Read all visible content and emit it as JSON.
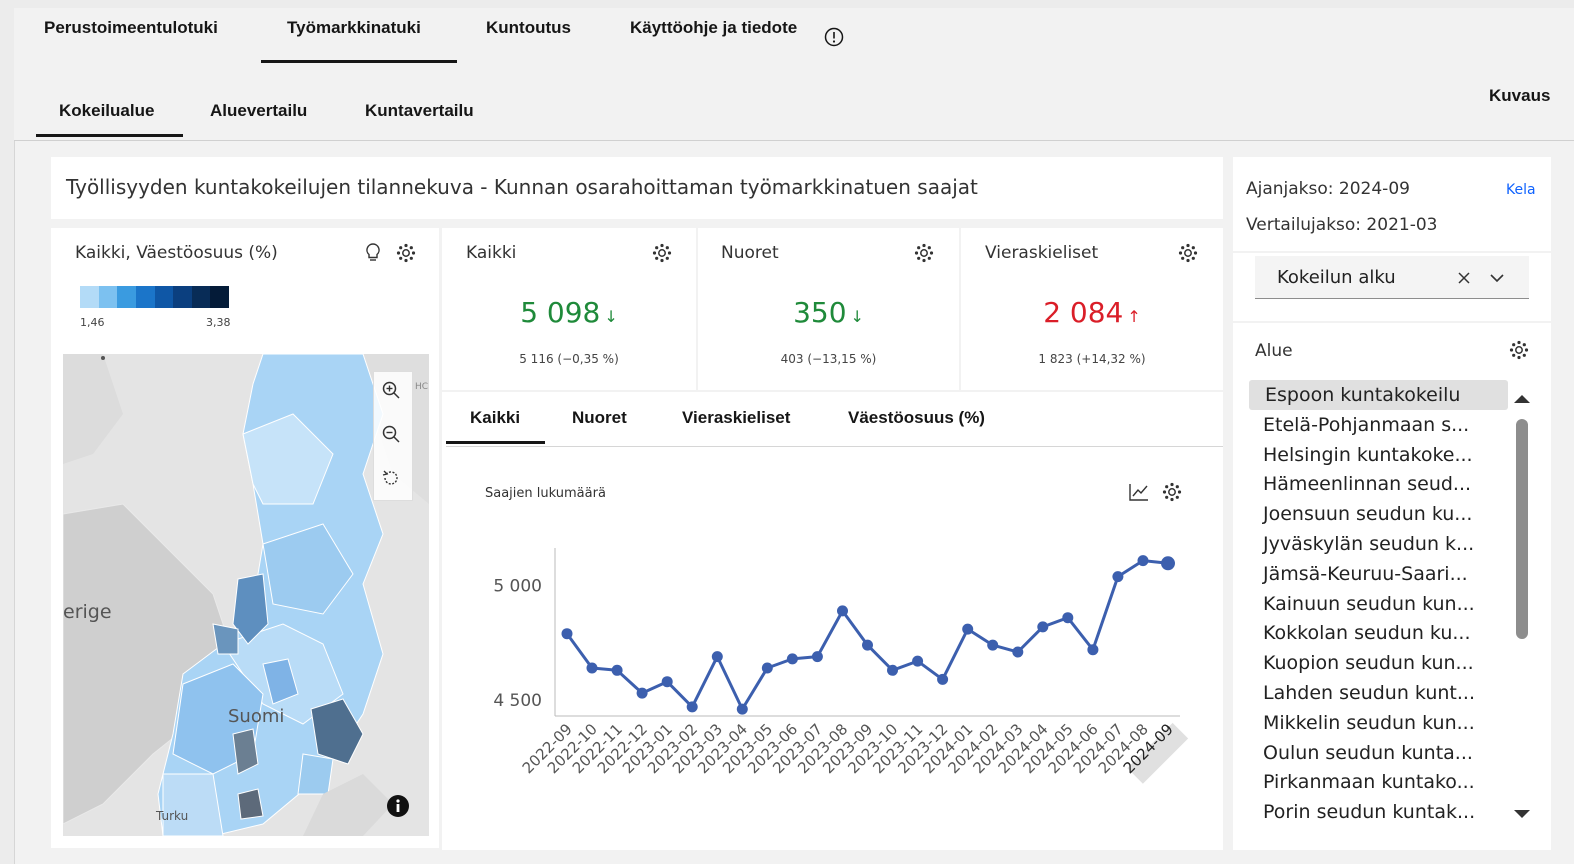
{
  "top_tabs": [
    {
      "label": "Perustoimeentulotuki"
    },
    {
      "label": "Työmarkkinatuki"
    },
    {
      "label": "Kuntoutus"
    },
    {
      "label": "Käyttöohje ja tiedote"
    }
  ],
  "sub_tabs": [
    {
      "label": "Kokeilualue"
    },
    {
      "label": "Aluevertailu"
    },
    {
      "label": "Kuntavertailu"
    }
  ],
  "kuvaus_label": "Kuvaus",
  "report_title": "Työllisyyden kuntakokeilujen tilannekuva - Kunnan osarahoittaman työmarkkinatuen saajat",
  "map": {
    "title": "Kaikki, Väestöosuus (%)",
    "legend_min": "1,46",
    "legend_max": "3,38",
    "legend_colors": [
      "#b3dbf7",
      "#7cc1f0",
      "#3a9be0",
      "#1b75c9",
      "#0f57a6",
      "#0b3f7f",
      "#082c57",
      "#041b38"
    ],
    "labels": {
      "sverige": "erige",
      "suomi": "Suomi",
      "turku": "Turku",
      "hc": "HC"
    }
  },
  "kpis": [
    {
      "title": "Kaikki",
      "value": "5 098",
      "arrow": "↓",
      "sub": "5 116 (−0,35 %)",
      "color": "#1f8a3a"
    },
    {
      "title": "Nuoret",
      "value": "350",
      "arrow": "↓",
      "sub": "403 (−13,15 %)",
      "color": "#1f8a3a"
    },
    {
      "title": "Vieraskieliset",
      "value": "2 084",
      "arrow": "↑",
      "sub": "1 823 (+14,32 %)",
      "color": "#da1e28"
    }
  ],
  "chart_tabs": [
    {
      "label": "Kaikki"
    },
    {
      "label": "Nuoret"
    },
    {
      "label": "Vieraskieliset"
    },
    {
      "label": "Väestöosuus (%)"
    }
  ],
  "chart_data": {
    "type": "line",
    "ylabel": "Saajien lukumäärä",
    "ytick_labels": [
      "5 000",
      "4 500"
    ],
    "yticks": [
      5000,
      4500
    ],
    "ylim": [
      4430,
      5200
    ],
    "color": "#3c5fae",
    "x": [
      "2022-09",
      "2022-10",
      "2022-11",
      "2022-12",
      "2023-01",
      "2023-02",
      "2023-03",
      "2023-04",
      "2023-05",
      "2023-06",
      "2023-07",
      "2023-08",
      "2023-09",
      "2023-10",
      "2023-11",
      "2023-12",
      "2024-01",
      "2024-02",
      "2024-03",
      "2024-04",
      "2024-05",
      "2024-06",
      "2024-07",
      "2024-08",
      "2024-09"
    ],
    "values": [
      4790,
      4640,
      4630,
      4530,
      4580,
      4470,
      4690,
      4460,
      4640,
      4680,
      4690,
      4890,
      4740,
      4630,
      4670,
      4590,
      4810,
      4740,
      4710,
      4820,
      4860,
      4720,
      5040,
      5110,
      5098
    ]
  },
  "side": {
    "ajanjakso": "Ajanjakso: 2024-09",
    "vertailujakso": "Vertailujakso: 2021-03",
    "source": "Kela",
    "dropdown_value": "Kokeilun alku",
    "alue_title": "Alue",
    "areas": [
      "Espoon kuntakokeilu",
      "Etelä-Pohjanmaan s...",
      "Helsingin kuntakoke...",
      "Hämeenlinnan seud...",
      "Joensuun seudun ku...",
      "Jyväskylän seudun k...",
      "Jämsä-Keuruu-Saari...",
      "Kainuun seudun kun...",
      "Kokkolan seudun ku...",
      "Kuopion seudun kun...",
      "Lahden seudun kunt...",
      "Mikkelin seudun kun...",
      "Oulun seudun kunta...",
      "Pirkanmaan kuntako...",
      "Porin seudun kuntak..."
    ]
  }
}
